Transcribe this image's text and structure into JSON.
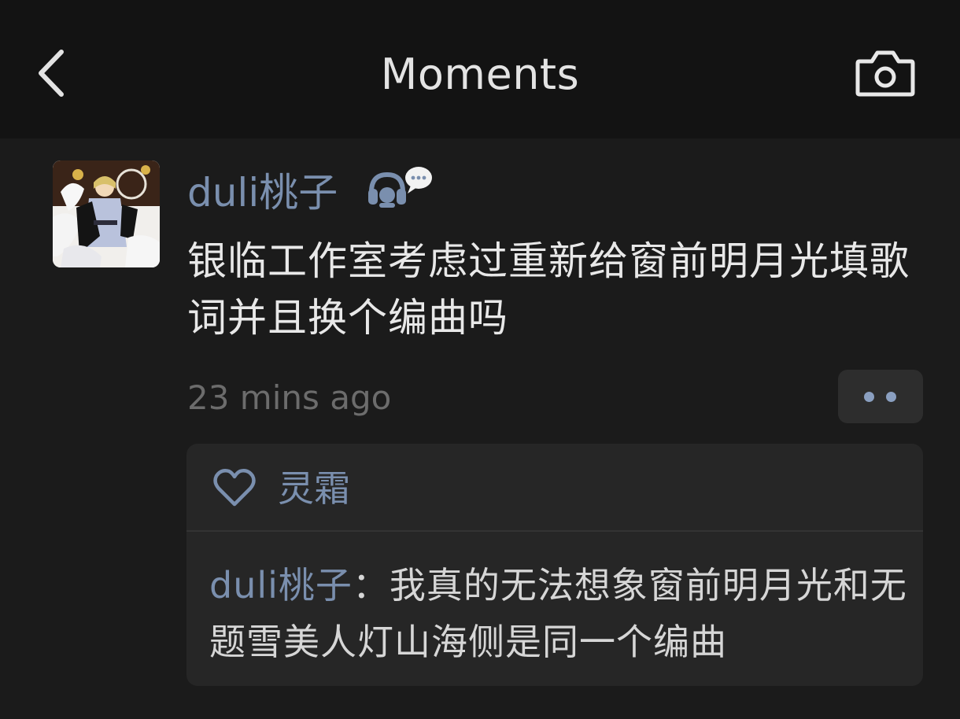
{
  "header": {
    "title": "Moments",
    "back_icon": "chevron-left-icon",
    "camera_icon": "camera-icon"
  },
  "post": {
    "author": "duli桃子",
    "status_icon": "headphones-chat-icon",
    "text": "银临工作室考虑过重新给窗前明月光填歌词并且换个编曲吗",
    "time": "23 mins ago",
    "more_icon": "more-dots-icon"
  },
  "likes": {
    "icon": "heart-icon",
    "names": "灵霜"
  },
  "comments": [
    {
      "author": "duli桃子",
      "separator": "：",
      "text": "我真的无法想象窗前明月光和无题雪美人灯山海侧是同一个编曲"
    }
  ],
  "colors": {
    "background": "#1b1b1b",
    "header_bg": "#131313",
    "link_blue": "#7a8fae",
    "text": "#e8e8e8",
    "muted": "#6c6c6c",
    "box_bg": "#262626"
  }
}
